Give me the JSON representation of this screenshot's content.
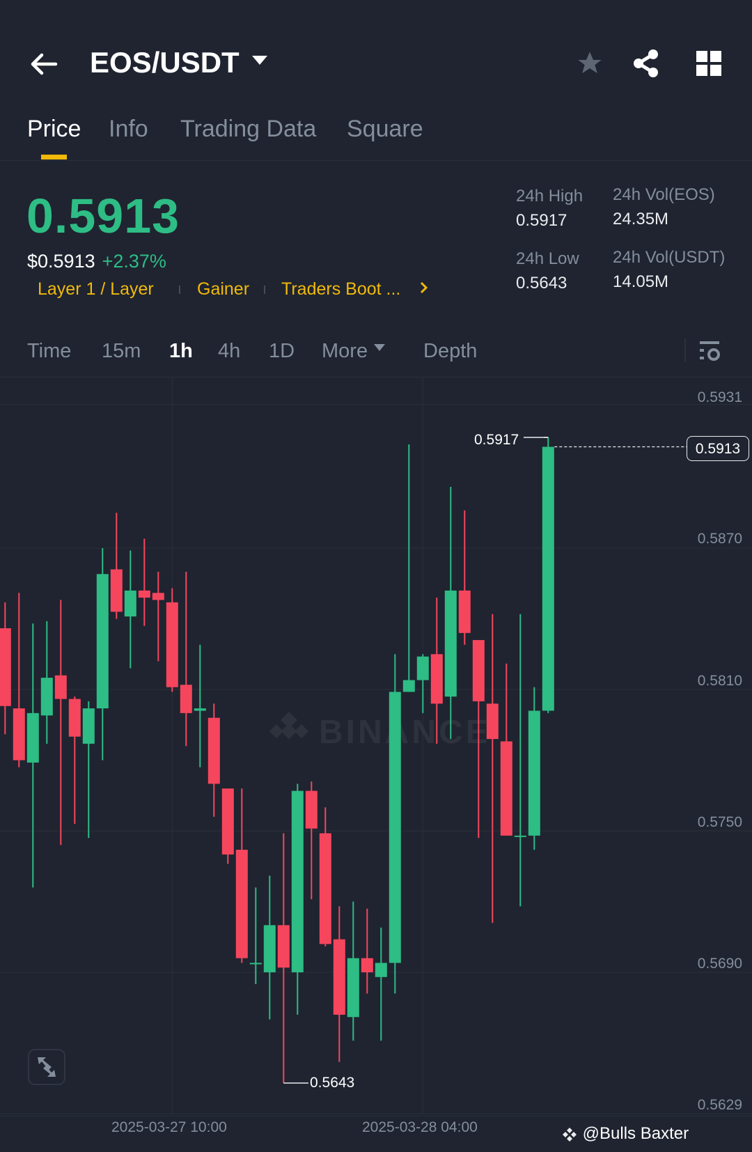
{
  "header": {
    "title": "EOS/USDT",
    "icons": [
      "back-arrow-icon",
      "favorite-star-icon",
      "share-icon",
      "grid-icon"
    ]
  },
  "tabs": [
    {
      "label": "Price",
      "active": true
    },
    {
      "label": "Info"
    },
    {
      "label": "Trading Data"
    },
    {
      "label": "Square"
    }
  ],
  "price": {
    "last": "0.5913",
    "fiat": "$0.5913",
    "change": "+2.37%"
  },
  "tags": [
    "Layer 1 / Layer",
    "Gainer",
    "Traders Boot ..."
  ],
  "stats": {
    "high_label": "24h High",
    "high": "0.5917",
    "low_label": "24h Low",
    "low": "0.5643",
    "vol_base_label": "24h Vol(EOS)",
    "vol_base": "24.35M",
    "vol_quote_label": "24h Vol(USDT)",
    "vol_quote": "14.05M"
  },
  "intervals": [
    {
      "label": "Time"
    },
    {
      "label": "15m"
    },
    {
      "label": "1h",
      "active": true
    },
    {
      "label": "4h"
    },
    {
      "label": "1D"
    },
    {
      "label": "More"
    },
    {
      "label": "Depth"
    }
  ],
  "watermark": {
    "brand": "BINANCE",
    "overlay": "@Bulls Baxter"
  },
  "colors": {
    "bg": "#1f2430",
    "up": "#2ebd85",
    "down": "#f6465d",
    "accent": "#f0b90b",
    "muted": "#848e9c"
  },
  "chart_data": {
    "type": "candlestick",
    "interval": "1h",
    "y_ticks": [
      "0.5931",
      "0.5870",
      "0.5810",
      "0.5750",
      "0.5690",
      "0.5629"
    ],
    "ylim": [
      0.5629,
      0.5931
    ],
    "x_ticks": [
      {
        "label": "2025-03-27 10:00",
        "index": 12
      },
      {
        "label": "2025-03-28 04:00",
        "index": 30
      }
    ],
    "current_price": "0.5913",
    "high_marker": {
      "label": "0.5917",
      "index": 39
    },
    "low_marker": {
      "label": "0.5643",
      "index": 20
    },
    "ohlc": [
      [
        0.5836,
        0.5847,
        0.5791,
        0.5803
      ],
      [
        0.5802,
        0.5851,
        0.5777,
        0.578
      ],
      [
        0.5779,
        0.5838,
        0.5726,
        0.58
      ],
      [
        0.5799,
        0.5839,
        0.5787,
        0.5815
      ],
      [
        0.5816,
        0.5848,
        0.5744,
        0.5806
      ],
      [
        0.5806,
        0.5807,
        0.5753,
        0.579
      ],
      [
        0.5787,
        0.5805,
        0.5747,
        0.5802
      ],
      [
        0.5802,
        0.587,
        0.578,
        0.5859
      ],
      [
        0.5861,
        0.5885,
        0.584,
        0.5843
      ],
      [
        0.5841,
        0.5869,
        0.5819,
        0.5852
      ],
      [
        0.5852,
        0.5874,
        0.5837,
        0.5849
      ],
      [
        0.5851,
        0.586,
        0.5822,
        0.5848
      ],
      [
        0.5847,
        0.5853,
        0.5809,
        0.5811
      ],
      [
        0.5812,
        0.586,
        0.5786,
        0.58
      ],
      [
        0.5801,
        0.5829,
        0.5777,
        0.5802
      ],
      [
        0.5798,
        0.5804,
        0.5756,
        0.577
      ],
      [
        0.5768,
        0.5768,
        0.5736,
        0.574
      ],
      [
        0.5742,
        0.5768,
        0.5694,
        0.5696
      ],
      [
        0.5694,
        0.5726,
        0.5685,
        0.5694
      ],
      [
        0.569,
        0.5731,
        0.567,
        0.571
      ],
      [
        0.571,
        0.5749,
        0.5643,
        0.5692
      ],
      [
        0.569,
        0.577,
        0.5672,
        0.5767
      ],
      [
        0.5767,
        0.5771,
        0.5721,
        0.5751
      ],
      [
        0.5749,
        0.576,
        0.5701,
        0.5702
      ],
      [
        0.5704,
        0.5718,
        0.5652,
        0.5672
      ],
      [
        0.5671,
        0.572,
        0.5661,
        0.5696
      ],
      [
        0.5696,
        0.5717,
        0.5681,
        0.569
      ],
      [
        0.5688,
        0.5709,
        0.5661,
        0.5694
      ],
      [
        0.5694,
        0.5825,
        0.5681,
        0.5809
      ],
      [
        0.5809,
        0.5914,
        0.5809,
        0.5814
      ],
      [
        0.5814,
        0.5825,
        0.58,
        0.5824
      ],
      [
        0.5825,
        0.5849,
        0.5787,
        0.5804
      ],
      [
        0.5807,
        0.5896,
        0.5789,
        0.5852
      ],
      [
        0.5852,
        0.5886,
        0.5829,
        0.5834
      ],
      [
        0.5831,
        0.5831,
        0.5747,
        0.5805
      ],
      [
        0.5804,
        0.5842,
        0.5711,
        0.5789
      ],
      [
        0.5788,
        0.5821,
        0.5748,
        0.5748
      ],
      [
        0.5748,
        0.5842,
        0.5718,
        0.5748
      ],
      [
        0.5748,
        0.5811,
        0.5742,
        0.5801
      ],
      [
        0.5801,
        0.5917,
        0.58,
        0.5913
      ]
    ]
  }
}
